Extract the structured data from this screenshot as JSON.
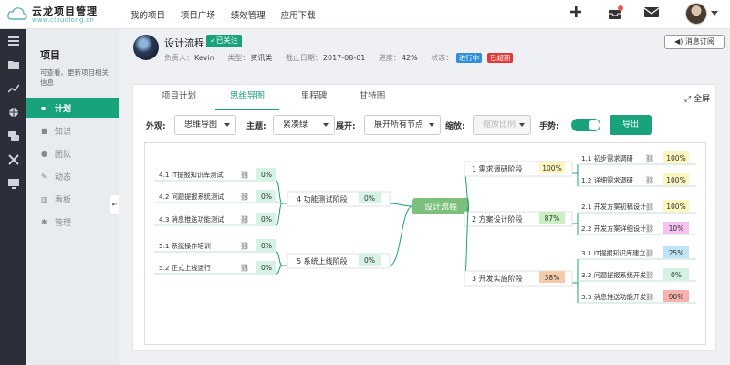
{
  "logo": {
    "title": "云龙项目管理",
    "subtitle": "www.cloudlong.cn"
  },
  "topnav": [
    "我的项目",
    "项目广场",
    "绩效管理",
    "应用下载"
  ],
  "topicons": [
    "plus-icon",
    "inbox-icon",
    "mail-icon"
  ],
  "sidebar": {
    "title": "项目",
    "desc": "可查看、更新项目相关信息",
    "items": [
      {
        "label": "计划",
        "icon": "sitemap-icon",
        "active": true
      },
      {
        "label": "知识",
        "icon": "folder-icon",
        "active": false
      },
      {
        "label": "团队",
        "icon": "users-icon",
        "active": false
      },
      {
        "label": "动态",
        "icon": "pin-icon",
        "active": false
      },
      {
        "label": "看板",
        "icon": "chart-icon",
        "active": false
      },
      {
        "label": "管理",
        "icon": "gear-icon",
        "active": false
      }
    ]
  },
  "project": {
    "name": "设计流程",
    "follow": "✓已关注",
    "owner_label": "负责人：",
    "owner": "Kevin",
    "type_label": "类型：",
    "type": "资讯类",
    "deadline_label": "截止日期：",
    "deadline": "2017-08-01",
    "progress_label": "进度：",
    "progress": "42%",
    "status_label": "状态：",
    "status": "进行中",
    "overdue": "已超期",
    "subscribe": "消息订阅"
  },
  "tabs": [
    {
      "label": "项目计划",
      "active": false
    },
    {
      "label": "思维导图",
      "active": true
    },
    {
      "label": "里程碑",
      "active": false
    },
    {
      "label": "甘特图",
      "active": false
    }
  ],
  "fullscreen": "全屏",
  "toolbar": {
    "appearance_label": "外观:",
    "appearance_value": "思维导图",
    "theme_label": "主题:",
    "theme_value": "紧凑绿",
    "expand_label": "展开:",
    "expand_value": "展开所有节点",
    "zoom_label": "缩放:",
    "zoom_placeholder": "缩放比例",
    "gesture_label": "手势:",
    "gesture_on": true,
    "export": "导出"
  },
  "mindmap": {
    "root": "设计流程",
    "right": [
      {
        "label": "1 需求调研阶段",
        "pct": "100%",
        "children": [
          {
            "label": "1.1 初步需求调研",
            "pct": "100%"
          },
          {
            "label": "1.2 详细需求调研",
            "pct": "100%"
          }
        ]
      },
      {
        "label": "2 方案设计阶段",
        "pct": "87%",
        "children": [
          {
            "label": "2.1 开发方案初稿设计",
            "pct": "100%"
          },
          {
            "label": "2.2 开发方案详细设计",
            "pct": "10%"
          }
        ]
      },
      {
        "label": "3 开发实施阶段",
        "pct": "38%",
        "children": [
          {
            "label": "3.1 IT提报知识库建立",
            "pct": "25%"
          },
          {
            "label": "3.2 问题提报系统开发",
            "pct": "0%"
          },
          {
            "label": "3.3 消息推送功能开发",
            "pct": "90%"
          }
        ]
      }
    ],
    "left": [
      {
        "label": "4 功能测试阶段",
        "pct": "0%",
        "children": [
          {
            "label": "4.1 IT提报知识库测试",
            "pct": "0%"
          },
          {
            "label": "4.2 问题提报系统测试",
            "pct": "0%"
          },
          {
            "label": "4.3 消息推送功能测试",
            "pct": "0%"
          }
        ]
      },
      {
        "label": "5 系统上线阶段",
        "pct": "0%",
        "children": [
          {
            "label": "5.1 系统操作培训",
            "pct": "0%"
          },
          {
            "label": "5.2 正式上线运行",
            "pct": "0%"
          }
        ]
      }
    ],
    "colors": {
      "green": "#19a37d",
      "root": "#7cc07c",
      "p100": "#fdf6bf",
      "p87": "#c9efc2",
      "p38": "#f6cba9",
      "p10": "#f6c2ef",
      "p25": "#bfe4f7",
      "p90": "#f7b1b1",
      "p0": "#d5f3e4"
    }
  }
}
